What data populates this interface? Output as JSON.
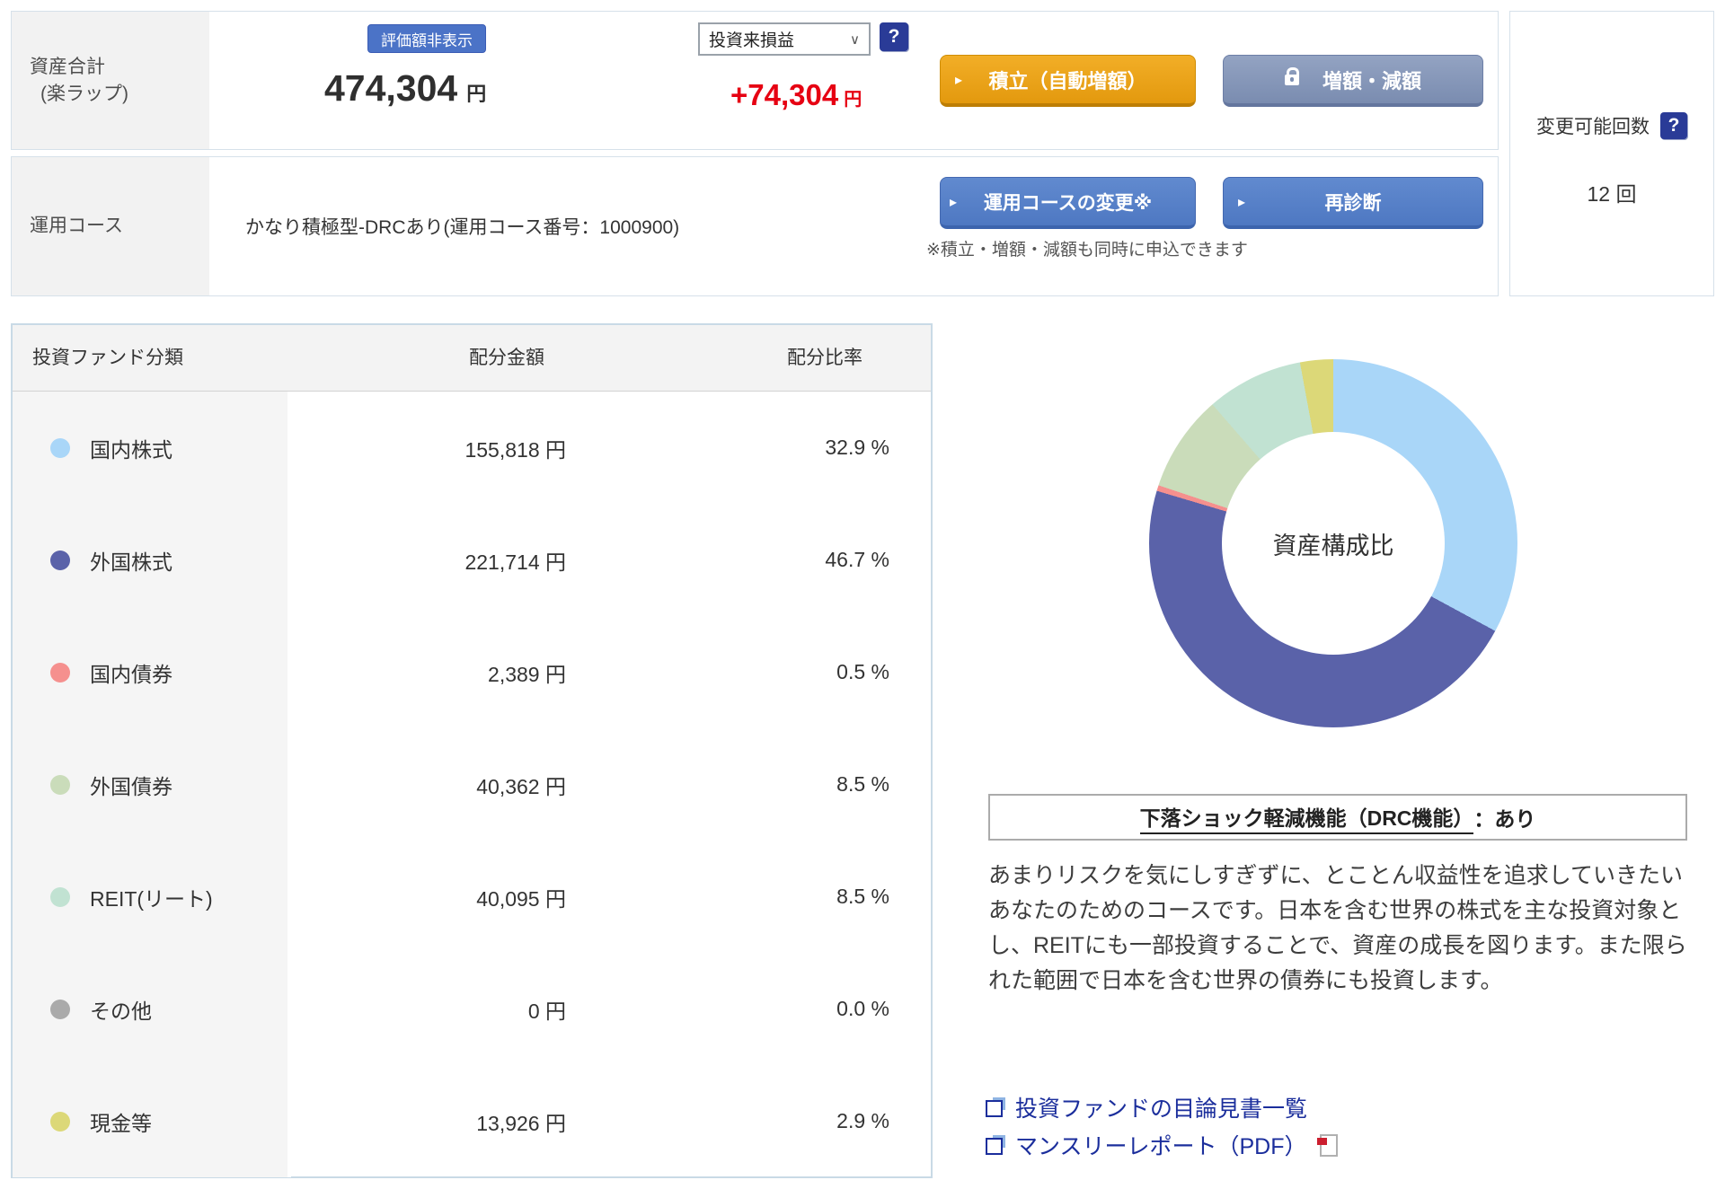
{
  "summary": {
    "asset_total_label": "資産合計",
    "asset_total_sublabel": "(楽ラップ)",
    "hide_value_button": "評価額非表示",
    "period_select_value": "投資来損益",
    "caret": "∨",
    "help_glyph": "?",
    "total_amount": "474,304",
    "total_unit": "円",
    "profit_amount": "+74,304",
    "profit_unit": "円",
    "arrow_glyph": "▸",
    "tsumitate_button": "積立（自動増額）",
    "zougaku_button": "増額・減額",
    "course_row_label": "運用コース",
    "course_name": "かなり積極型-DRCあり(運用コース番号：1000900)",
    "course_change_button": "運用コースの変更※",
    "rediagnosis_button": "再診断",
    "note": "※積立・増額・減額も同時に申込できます",
    "change_count_label": "変更可能回数",
    "change_count_value": "12 回"
  },
  "allocation_table": {
    "headers": [
      "投資ファンド分類",
      "配分金額",
      "配分比率"
    ],
    "rows": [
      {
        "label": "国内株式",
        "color": "#a9d6f8",
        "amount": "155,818 円",
        "ratio": "32.9 %"
      },
      {
        "label": "外国株式",
        "color": "#5a62a9",
        "amount": "221,714 円",
        "ratio": "46.7 %"
      },
      {
        "label": "国内債券",
        "color": "#f5908e",
        "amount": "2,389 円",
        "ratio": "0.5 %"
      },
      {
        "label": "外国債券",
        "color": "#cadcba",
        "amount": "40,362 円",
        "ratio": "8.5 %"
      },
      {
        "label": "REIT(リート)",
        "color": "#c1e2d2",
        "amount": "40,095 円",
        "ratio": "8.5 %"
      },
      {
        "label": "その他",
        "color": "#aaaaaa",
        "amount": "0 円",
        "ratio": "0.0 %"
      },
      {
        "label": "現金等",
        "color": "#dcd878",
        "amount": "13,926 円",
        "ratio": "2.9 %"
      }
    ]
  },
  "chart_data": {
    "type": "pie",
    "donut": true,
    "center_label": "資産構成比",
    "categories": [
      "国内株式",
      "外国株式",
      "国内債券",
      "外国債券",
      "REIT(リート)",
      "その他",
      "現金等"
    ],
    "values": [
      32.9,
      46.7,
      0.5,
      8.5,
      8.5,
      0.0,
      2.9
    ],
    "amounts_yen": [
      155818,
      221714,
      2389,
      40362,
      40095,
      0,
      13926
    ],
    "colors": [
      "#a9d6f8",
      "#5a62a9",
      "#f5908e",
      "#cadcba",
      "#c1e2d2",
      "#aaaaaa",
      "#dcd878"
    ],
    "start_angle_deg": 0,
    "direction": "clockwise",
    "legend_position": "table-left"
  },
  "drc": {
    "title_underlined": "下落ショック軽減機能（DRC機能）",
    "title_suffix": "：あり"
  },
  "description": "あまりリスクを気にしすぎずに、とことん収益性を追求していきたいあなたのためのコースです。日本を含む世界の株式を主な投資対象とし、REITにも一部投資することで、資産の成長を図ります。また限られた範囲で日本を含む世界の債券にも投資します。",
  "links": [
    {
      "label": "投資ファンドの目論見書一覧",
      "pdf": false
    },
    {
      "label": "マンスリーレポート（PDF）",
      "pdf": true
    }
  ]
}
